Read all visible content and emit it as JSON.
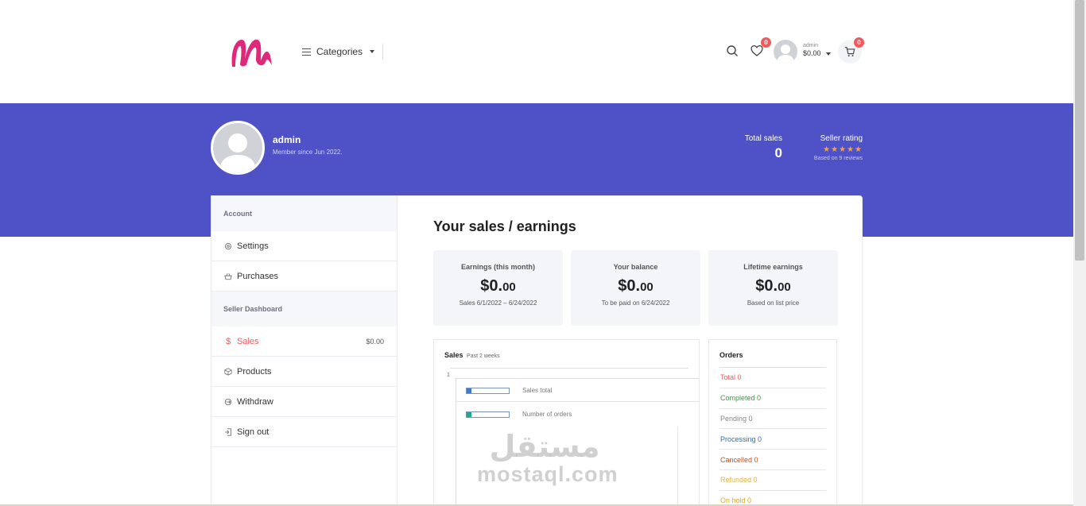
{
  "header": {
    "categories_label": "Categories",
    "wishlist_count": "0",
    "cart_count": "0",
    "user_name": "admin",
    "user_balance": "$0.00"
  },
  "profile": {
    "name": "admin",
    "member_since": "Member since Jun 2022.",
    "total_sales_label": "Total sales",
    "total_sales_value": "0",
    "seller_rating_label": "Seller rating",
    "stars": "★★★★★",
    "reviews": "Based on 9 reviews"
  },
  "sidebar": {
    "account_section": "Account",
    "settings": "Settings",
    "purchases": "Purchases",
    "seller_section": "Seller Dashboard",
    "sales": "Sales",
    "sales_amount": "$0.00",
    "products": "Products",
    "withdraw": "Withdraw",
    "sign_out": "Sign out"
  },
  "main": {
    "title": "Your sales / earnings",
    "cards": [
      {
        "label": "Earnings (this month)",
        "dollars": "$0.",
        "cents": "00",
        "sub": "Sales 6/1/2022 – 6/24/2022"
      },
      {
        "label": "Your balance",
        "dollars": "$0.",
        "cents": "00",
        "sub": "To be paid on 6/24/2022"
      },
      {
        "label": "Lifetime earnings",
        "dollars": "$0.",
        "cents": "00",
        "sub": "Based on list price"
      }
    ],
    "sales_chart": {
      "title": "Sales",
      "subtitle": "Past 2 weeks",
      "axis_value": "1",
      "legend": [
        "Sales total",
        "Number of orders"
      ]
    },
    "orders": {
      "title": "Orders",
      "rows": [
        {
          "label": "Total 0",
          "color": "#f05a5a"
        },
        {
          "label": "Completed 0",
          "color": "#3c9a3c"
        },
        {
          "label": "Pending 0",
          "color": "#888888"
        },
        {
          "label": "Processing 0",
          "color": "#2a6fb8"
        },
        {
          "label": "Cancelled 0",
          "color": "#d9480f"
        },
        {
          "label": "Refunded 0",
          "color": "#e0b341"
        },
        {
          "label": "On hold 0",
          "color": "#e0a62a"
        }
      ]
    }
  },
  "watermark": {
    "arabic": "مستقل",
    "latin": "mostaql.com"
  },
  "colors": {
    "brand": "#4f52c6",
    "accent": "#f05a5a",
    "logo": "#e0287a"
  }
}
